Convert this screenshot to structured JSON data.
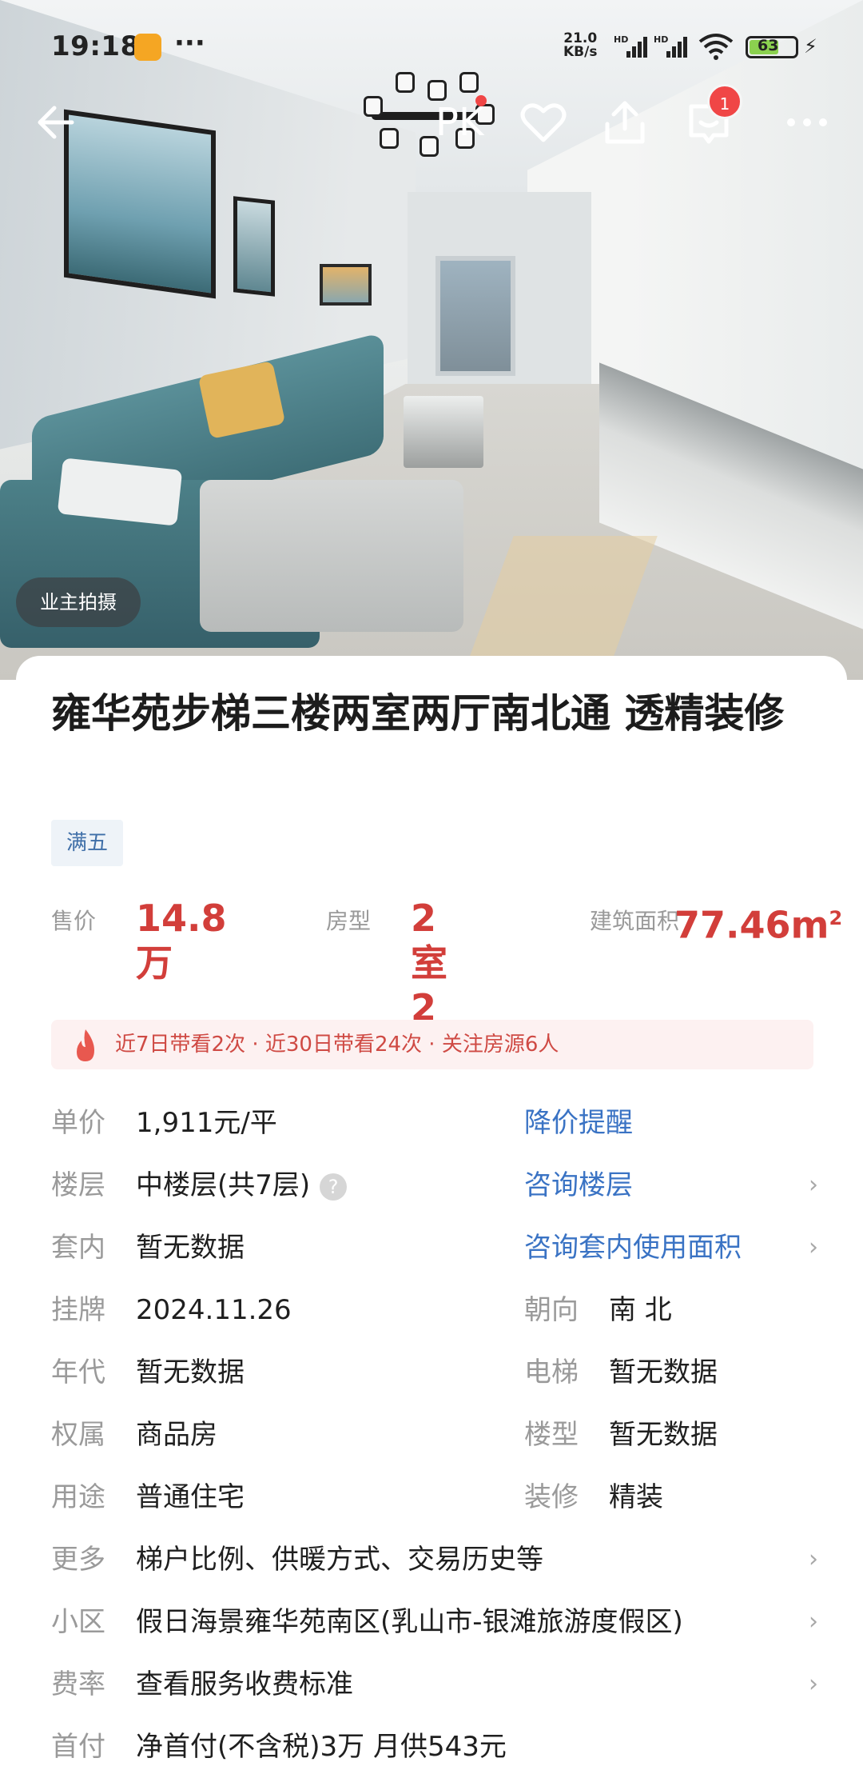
{
  "status": {
    "time": "19:18",
    "more": "···",
    "net_speed_value": "21.0",
    "net_speed_unit": "KB/s",
    "signal_label_1": "HD",
    "signal_label_2": "HD",
    "battery": "63"
  },
  "top_bar": {
    "pk_label": "PK",
    "cart_badge": "1"
  },
  "hero": {
    "photo_tag": "业主拍摄"
  },
  "listing": {
    "title": "雍华苑步梯三楼两室两厅南北通 透精装修",
    "tag": "满五",
    "price_value": "14.8万",
    "price_label": "售价",
    "layout_value": "2室2厅",
    "layout_label": "房型",
    "area_value": "77.46m",
    "area_sup": "2",
    "area_label": "建筑面积",
    "heat_text": "近7日带看2次 · 近30日带看24次 · 关注房源6人"
  },
  "details": {
    "unit_price_key": "单价",
    "unit_price_val": "1,911元/平",
    "price_alert": "降价提醒",
    "floor_key": "楼层",
    "floor_val": "中楼层(共7层)",
    "floor_link": "咨询楼层",
    "inner_key": "套内",
    "inner_val": "暂无数据",
    "inner_link": "咨询套内使用面积",
    "listed_key": "挂牌",
    "listed_val": "2024.11.26",
    "orient_key": "朝向",
    "orient_val": "南 北",
    "year_key": "年代",
    "year_val": "暂无数据",
    "elevator_key": "电梯",
    "elevator_val": "暂无数据",
    "own_key": "权属",
    "own_val": "商品房",
    "building_key": "楼型",
    "building_val": "暂无数据",
    "use_key": "用途",
    "use_val": "普通住宅",
    "deco_key": "装修",
    "deco_val": "精装",
    "more_key": "更多",
    "more_val": "梯户比例、供暖方式、交易历史等",
    "community_key": "小区",
    "community_val": "假日海景雍华苑南区(乳山市-银滩旅游度假区)",
    "fee_key": "费率",
    "fee_val": "查看服务收费标准",
    "down_key": "首付",
    "down_val": "净首付(不含税)3万 月供543元"
  }
}
